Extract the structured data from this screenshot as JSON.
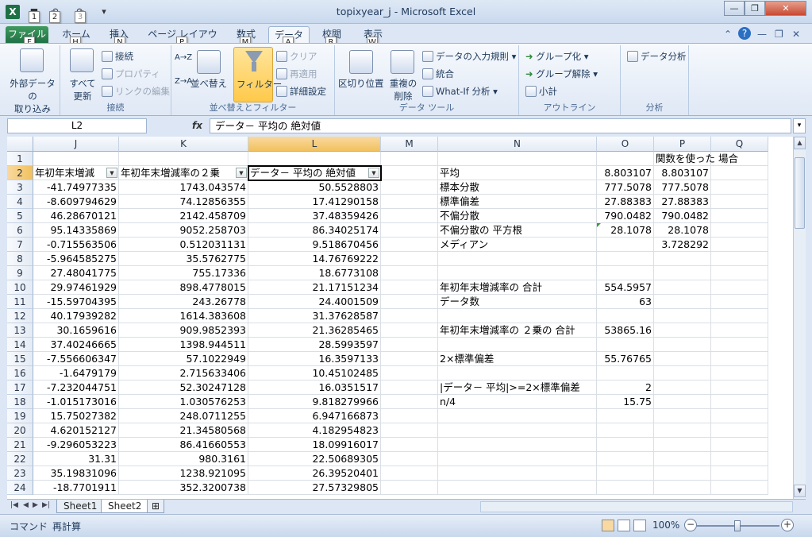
{
  "titlebar": {
    "title": "topixyear_j - Microsoft Excel",
    "keytips": [
      "1",
      "2",
      "3"
    ]
  },
  "tabs": {
    "file": "ファイル",
    "items": [
      "ホーム",
      "挿入",
      "ページ レイアウト",
      "数式",
      "データ",
      "校閲",
      "表示"
    ],
    "keytips": [
      "F",
      "H",
      "N",
      "P",
      "M",
      "A",
      "R",
      "W"
    ],
    "active": "データ"
  },
  "ribbon": {
    "external_data": "外部データの\n取り込み",
    "refresh_all": "すべて\n更新",
    "connections": "接続",
    "properties": "プロパティ",
    "edit_links": "リンクの編集",
    "group_connections": "接続",
    "sort_az": "A→Z",
    "sort_za": "Z→A",
    "sort": "並べ替え",
    "filter": "フィルター",
    "clear": "クリア",
    "reapply": "再適用",
    "advanced": "詳細設定",
    "group_sort_filter": "並べ替えとフィルター",
    "text_to_columns": "区切り位置",
    "remove_duplicates": "重複の\n削除",
    "data_validation": "データの入力規則",
    "consolidate": "統合",
    "what_if": "What-If 分析",
    "group_data_tools": "データ ツール",
    "group": "グループ化",
    "ungroup": "グループ解除",
    "subtotal": "小計",
    "group_outline": "アウトライン",
    "data_analysis": "データ分析",
    "group_analysis": "分析"
  },
  "formula_bar": {
    "name_box": "L2",
    "fx": "fx",
    "content": "データ－ 平均の 絶対値"
  },
  "columns": [
    {
      "id": "J",
      "width": 108
    },
    {
      "id": "K",
      "width": 163
    },
    {
      "id": "L",
      "width": 167
    },
    {
      "id": "M",
      "width": 72
    },
    {
      "id": "N",
      "width": 200
    },
    {
      "id": "O",
      "width": 72
    },
    {
      "id": "P",
      "width": 72
    },
    {
      "id": "Q",
      "width": 72
    }
  ],
  "selected_column": "L",
  "selected_row": "2",
  "rows": [
    {
      "n": "1",
      "J": "",
      "K": "",
      "L": "",
      "N": "",
      "O": "",
      "P": "関数を使った 場合"
    },
    {
      "n": "2",
      "J": "年初年末増減",
      "K": "年初年末増減率の２乗",
      "L": "データ－ 平均の 絶対値",
      "N": "平均",
      "O": "8.803107",
      "P": "8.803107"
    },
    {
      "n": "3",
      "J": "-41.74977335",
      "K": "1743.043574",
      "L": "50.5528803",
      "N": "標本分散",
      "O": "777.5078",
      "P": "777.5078"
    },
    {
      "n": "4",
      "J": "-8.609794629",
      "K": "74.12856355",
      "L": "17.41290158",
      "N": "標準偏差",
      "O": "27.88383",
      "P": "27.88383"
    },
    {
      "n": "5",
      "J": "46.28670121",
      "K": "2142.458709",
      "L": "37.48359426",
      "N": "不偏分散",
      "O": "790.0482",
      "P": "790.0482"
    },
    {
      "n": "6",
      "J": "95.14335869",
      "K": "9052.258703",
      "L": "86.34025174",
      "N": "不偏分散の 平方根",
      "O": "28.1078",
      "P": "28.1078"
    },
    {
      "n": "7",
      "J": "-0.715563506",
      "K": "0.512031131",
      "L": "9.518670456",
      "N": "メディアン",
      "O": "",
      "P": "3.728292"
    },
    {
      "n": "8",
      "J": "-5.964585275",
      "K": "35.5762775",
      "L": "14.76769222",
      "N": "",
      "O": "",
      "P": ""
    },
    {
      "n": "9",
      "J": "27.48041775",
      "K": "755.17336",
      "L": "18.6773108",
      "N": "",
      "O": "",
      "P": ""
    },
    {
      "n": "10",
      "J": "29.97461929",
      "K": "898.4778015",
      "L": "21.17151234",
      "N": "年初年末増減率の 合計",
      "O": "554.5957",
      "P": ""
    },
    {
      "n": "11",
      "J": "-15.59704395",
      "K": "243.26778",
      "L": "24.4001509",
      "N": "データ数",
      "O": "63",
      "P": ""
    },
    {
      "n": "12",
      "J": "40.17939282",
      "K": "1614.383608",
      "L": "31.37628587",
      "N": "",
      "O": "",
      "P": ""
    },
    {
      "n": "13",
      "J": "30.1659616",
      "K": "909.9852393",
      "L": "21.36285465",
      "N": "年初年末増減率の ２乗の 合計",
      "O": "53865.16",
      "P": ""
    },
    {
      "n": "14",
      "J": "37.40246665",
      "K": "1398.944511",
      "L": "28.5993597",
      "N": "",
      "O": "",
      "P": ""
    },
    {
      "n": "15",
      "J": "-7.556606347",
      "K": "57.1022949",
      "L": "16.3597133",
      "N": "2×標準偏差",
      "O": "55.76765",
      "P": ""
    },
    {
      "n": "16",
      "J": "-1.6479179",
      "K": "2.715633406",
      "L": "10.45102485",
      "N": "",
      "O": "",
      "P": ""
    },
    {
      "n": "17",
      "J": "-7.232044751",
      "K": "52.30247128",
      "L": "16.0351517",
      "N": "|データ－ 平均|>=2×標準偏差",
      "O": "2",
      "P": ""
    },
    {
      "n": "18",
      "J": "-1.015173016",
      "K": "1.030576253",
      "L": "9.818279966",
      "N": "n/4",
      "O": "15.75",
      "P": ""
    },
    {
      "n": "19",
      "J": "15.75027382",
      "K": "248.0711255",
      "L": "6.947166873",
      "N": "",
      "O": "",
      "P": ""
    },
    {
      "n": "20",
      "J": "4.620152127",
      "K": "21.34580568",
      "L": "4.182954823",
      "N": "",
      "O": "",
      "P": ""
    },
    {
      "n": "21",
      "J": "-9.296053223",
      "K": "86.41660553",
      "L": "18.09916017",
      "N": "",
      "O": "",
      "P": ""
    },
    {
      "n": "22",
      "J": "31.31",
      "K": "980.3161",
      "L": "22.50689305",
      "N": "",
      "O": "",
      "P": ""
    },
    {
      "n": "23",
      "J": "35.19831096",
      "K": "1238.921095",
      "L": "26.39520401",
      "N": "",
      "O": "",
      "P": ""
    },
    {
      "n": "24",
      "J": "-18.7701911",
      "K": "352.3200738",
      "L": "27.57329805",
      "N": "",
      "O": "",
      "P": ""
    }
  ],
  "sheets": {
    "tabs": [
      "Sheet1",
      "Sheet2"
    ],
    "active": "Sheet2"
  },
  "statusbar": {
    "mode": "コマンド",
    "recalc": "再計算",
    "zoom": "100%"
  }
}
